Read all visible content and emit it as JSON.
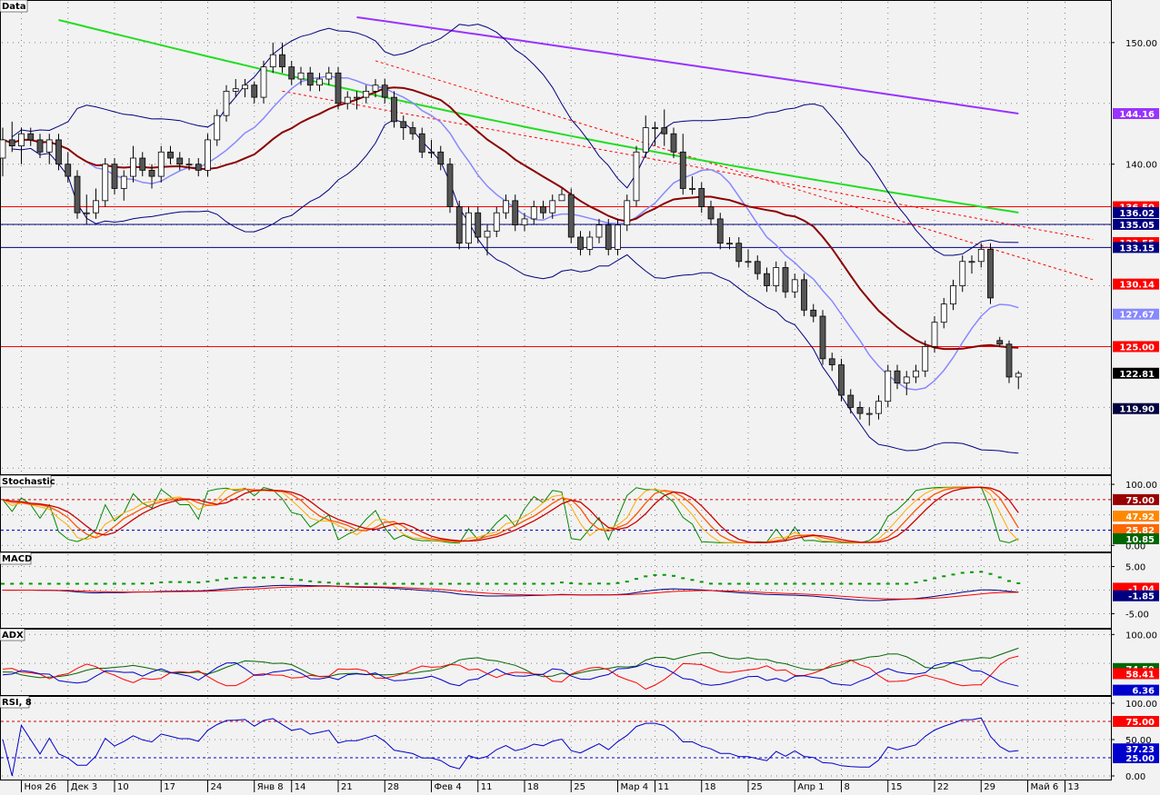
{
  "panels": {
    "price": {
      "title": "Data"
    },
    "stochastic": {
      "title": "Stochastic"
    },
    "macd": {
      "title": "MACD"
    },
    "adx": {
      "title": "ADX"
    },
    "rsi": {
      "title": "RSI, 8"
    }
  },
  "colors": {
    "background": "#f2f2f2",
    "grid": "#808080",
    "candle_up": "#ffffff",
    "candle_down": "#555555",
    "sma_long": "#9933ff",
    "sma_mid": "#22dd22",
    "sma_short": "#8b0000",
    "bb_mid": "#8888ff",
    "bb_band": "#000080",
    "level_red": "#ff0000",
    "level_blue": "#000080"
  },
  "x_axis": {
    "ticks": [
      {
        "label": "Ноя 26",
        "i": 2
      },
      {
        "label": "Дек 3",
        "i": 7
      },
      {
        "label": "10",
        "i": 12
      },
      {
        "label": "17",
        "i": 17
      },
      {
        "label": "24",
        "i": 22
      },
      {
        "label": "Янв 8",
        "i": 27
      },
      {
        "label": "14",
        "i": 31
      },
      {
        "label": "21",
        "i": 36
      },
      {
        "label": "28",
        "i": 41
      },
      {
        "label": "Фев 4",
        "i": 46
      },
      {
        "label": "11",
        "i": 51
      },
      {
        "label": "18",
        "i": 56
      },
      {
        "label": "25",
        "i": 61
      },
      {
        "label": "Мар 4",
        "i": 66
      },
      {
        "label": "11",
        "i": 70
      },
      {
        "label": "18",
        "i": 75
      },
      {
        "label": "25",
        "i": 80
      },
      {
        "label": "Апр 1",
        "i": 85
      },
      {
        "label": "8",
        "i": 90
      },
      {
        "label": "15",
        "i": 95
      },
      {
        "label": "22",
        "i": 100
      },
      {
        "label": "29",
        "i": 105
      },
      {
        "label": "Май 6",
        "i": 110
      },
      {
        "label": "13",
        "i": 114
      }
    ]
  },
  "right_labels": {
    "price_ticks": [
      "150.00",
      "140.00"
    ],
    "price_badges": [
      {
        "text": "144.16",
        "value": 144.16,
        "color": "#9933ff"
      },
      {
        "text": "136.50",
        "value": 136.5,
        "color": "#ff0000"
      },
      {
        "text": "136.02",
        "value": 136.02,
        "color": "#000080"
      },
      {
        "text": "135.05",
        "value": 135.05,
        "color": "#000080"
      },
      {
        "text": "133.55",
        "value": 133.55,
        "color": "#ff0000"
      },
      {
        "text": "133.15",
        "value": 133.15,
        "color": "#000080"
      },
      {
        "text": "130.14",
        "value": 130.14,
        "color": "#ff0000"
      },
      {
        "text": "127.67",
        "value": 127.67,
        "color": "#8888ff"
      },
      {
        "text": "125.00",
        "value": 125.0,
        "color": "#ff0000"
      },
      {
        "text": "122.81",
        "value": 122.81,
        "color": "#000000"
      },
      {
        "text": "119.90",
        "value": 119.9,
        "color": "#000040"
      }
    ],
    "stoch_ticks": [
      "100.00",
      "0.00"
    ],
    "stoch_badges": [
      {
        "text": "75.00",
        "value": 75,
        "color": "#990000"
      },
      {
        "text": "47.92",
        "value": 47.92,
        "color": "#ff8800"
      },
      {
        "text": "25.82",
        "value": 25.82,
        "color": "#ff6600"
      },
      {
        "text": "10.85",
        "value": 10.85,
        "color": "#006600"
      }
    ],
    "macd_ticks": [
      "5.00",
      "-5.00"
    ],
    "macd_badges": [
      {
        "text": "-1.04",
        "value": -1.04,
        "color": "#ff0000"
      },
      {
        "text": "-1.85",
        "value": -1.85,
        "color": "#000080"
      }
    ],
    "adx_ticks": [
      "100.00"
    ],
    "adx_badges": [
      {
        "text": "74.59",
        "value": 74.59,
        "color": "#006600"
      },
      {
        "text": "58.41",
        "value": 58.41,
        "color": "#ff0000"
      },
      {
        "text": "6.36",
        "value": 6.36,
        "color": "#0000cc"
      }
    ],
    "rsi_ticks": [
      "100.00",
      "50.00",
      "0.00"
    ],
    "rsi_badges": [
      {
        "text": "75.00",
        "value": 75,
        "color": "#ff0000"
      },
      {
        "text": "37.23",
        "value": 37.23,
        "color": "#0000cc"
      },
      {
        "text": "25.00",
        "value": 25,
        "color": "#0000cc"
      }
    ]
  },
  "chart_data": {
    "type": "candlestick",
    "price_range": [
      114.5,
      153.5
    ],
    "horizontal_levels": [
      {
        "value": 136.5,
        "color": "#ff0000"
      },
      {
        "value": 135.05,
        "color": "#000080"
      },
      {
        "value": 133.15,
        "color": "#000080"
      },
      {
        "value": 125.0,
        "color": "#ff0000"
      }
    ],
    "trend_lines": [
      {
        "from": [
          40,
          148.5
        ],
        "to": [
          117,
          130.5
        ],
        "color": "#ff0000"
      },
      {
        "from": [
          30,
          146.0
        ],
        "to": [
          117,
          133.8
        ],
        "color": "#ff0000"
      }
    ],
    "closes": [
      142,
      141.5,
      142.5,
      142.0,
      141.0,
      142.0,
      140.0,
      139.0,
      136.0,
      136.0,
      137.0,
      140.0,
      138.0,
      139.0,
      140.5,
      139.5,
      139.0,
      141.0,
      140.5,
      140.0,
      140.0,
      139.5,
      142.0,
      144.0,
      146.0,
      146.2,
      146.5,
      145.5,
      148.0,
      149.0,
      148.0,
      147.0,
      147.5,
      146.5,
      147.0,
      147.5,
      145.0,
      145.5,
      145.5,
      146.0,
      146.5,
      145.5,
      143.5,
      143.0,
      142.5,
      141.0,
      141.0,
      140.0,
      136.5,
      133.5,
      136.0,
      134.0,
      134.5,
      136.0,
      137.0,
      135.0,
      135.5,
      136.5,
      136.0,
      137.0,
      137.5,
      134.0,
      133.0,
      134.0,
      135.0,
      133.0,
      135.0,
      137.0,
      141.0,
      143.0,
      143.0,
      142.5,
      141.0,
      138.0,
      138.0,
      136.5,
      135.5,
      133.5,
      133.5,
      132.0,
      132.0,
      131.0,
      130.0,
      131.5,
      129.5,
      130.5,
      128.0,
      127.5,
      124.0,
      123.5,
      121.0,
      120.0,
      119.5,
      119.5,
      120.5,
      123.0,
      122.0,
      122.5,
      123.0,
      125.0,
      127.0,
      128.5,
      130.0,
      132.0,
      132.0,
      133.0,
      129.0,
      125.5,
      123.0,
      122.5
    ],
    "candles_sample_note": "OHLC estimated from chart",
    "ohlc": [
      [
        140.5,
        143.0,
        139.0,
        142.0
      ],
      [
        142.0,
        143.5,
        141.0,
        141.5
      ],
      [
        141.5,
        143.0,
        140.0,
        142.5
      ],
      [
        142.5,
        143.0,
        141.5,
        142.0
      ],
      [
        142.0,
        142.5,
        140.5,
        141.0
      ],
      [
        141.0,
        142.5,
        140.0,
        142.0
      ],
      [
        142.0,
        142.5,
        139.5,
        140.0
      ],
      [
        140.0,
        141.0,
        138.5,
        139.0
      ],
      [
        139.0,
        139.5,
        135.5,
        136.0
      ],
      [
        136.0,
        137.5,
        135.0,
        136.0
      ],
      [
        136.0,
        138.0,
        135.5,
        137.0
      ],
      [
        137.0,
        140.5,
        136.5,
        140.0
      ],
      [
        140.0,
        140.5,
        137.5,
        138.0
      ],
      [
        138.0,
        139.5,
        137.0,
        139.0
      ],
      [
        139.0,
        141.5,
        138.5,
        140.5
      ],
      [
        140.5,
        141.0,
        139.0,
        139.5
      ],
      [
        139.5,
        140.0,
        138.0,
        139.0
      ],
      [
        139.0,
        141.5,
        138.5,
        141.0
      ],
      [
        141.0,
        141.5,
        140.0,
        140.5
      ],
      [
        140.5,
        141.0,
        139.5,
        140.0
      ],
      [
        140.0,
        140.5,
        139.5,
        140.0
      ],
      [
        140.0,
        140.5,
        139.0,
        139.5
      ],
      [
        139.5,
        142.5,
        139.0,
        142.0
      ],
      [
        142.0,
        144.5,
        141.5,
        144.0
      ],
      [
        144.0,
        146.5,
        143.5,
        146.0
      ],
      [
        146.0,
        147.0,
        145.5,
        146.2
      ],
      [
        146.2,
        147.0,
        145.5,
        146.5
      ],
      [
        146.5,
        146.8,
        145.0,
        145.5
      ],
      [
        145.5,
        148.5,
        145.0,
        148.0
      ],
      [
        148.0,
        150.0,
        147.5,
        149.0
      ],
      [
        149.0,
        150.0,
        147.5,
        148.0
      ],
      [
        148.0,
        148.5,
        146.5,
        147.0
      ],
      [
        147.0,
        148.0,
        146.5,
        147.5
      ],
      [
        147.5,
        148.0,
        146.0,
        146.5
      ],
      [
        146.5,
        147.5,
        146.0,
        147.0
      ],
      [
        147.0,
        148.0,
        146.5,
        147.5
      ],
      [
        147.5,
        148.0,
        144.5,
        145.0
      ],
      [
        145.0,
        146.0,
        144.5,
        145.5
      ],
      [
        145.5,
        146.0,
        144.5,
        145.5
      ],
      [
        145.5,
        146.5,
        145.0,
        146.0
      ],
      [
        146.0,
        147.0,
        145.5,
        146.5
      ],
      [
        146.5,
        147.0,
        145.0,
        145.5
      ],
      [
        145.5,
        146.0,
        143.0,
        143.5
      ],
      [
        143.5,
        144.0,
        142.0,
        143.0
      ],
      [
        143.0,
        143.5,
        142.0,
        142.5
      ],
      [
        142.5,
        143.0,
        140.5,
        141.0
      ],
      [
        141.0,
        142.0,
        140.5,
        141.0
      ],
      [
        141.0,
        141.5,
        139.5,
        140.0
      ],
      [
        140.0,
        140.5,
        136.0,
        136.5
      ],
      [
        136.5,
        137.0,
        133.0,
        133.5
      ],
      [
        133.5,
        136.5,
        133.0,
        136.0
      ],
      [
        136.0,
        136.5,
        133.5,
        134.0
      ],
      [
        134.0,
        135.0,
        132.5,
        134.5
      ],
      [
        134.5,
        136.5,
        134.0,
        136.0
      ],
      [
        136.0,
        137.5,
        135.5,
        137.0
      ],
      [
        137.0,
        137.5,
        134.5,
        135.0
      ],
      [
        135.0,
        136.0,
        134.5,
        135.5
      ],
      [
        135.5,
        137.0,
        135.0,
        136.5
      ],
      [
        136.5,
        137.0,
        135.5,
        136.0
      ],
      [
        136.0,
        137.5,
        135.5,
        137.0
      ],
      [
        137.0,
        138.0,
        137.0,
        137.5
      ],
      [
        137.5,
        138.0,
        133.5,
        134.0
      ],
      [
        134.0,
        134.5,
        132.5,
        133.0
      ],
      [
        133.0,
        134.5,
        132.5,
        134.0
      ],
      [
        134.0,
        135.5,
        133.5,
        135.0
      ],
      [
        135.0,
        135.5,
        132.5,
        133.0
      ],
      [
        133.0,
        135.5,
        132.5,
        135.0
      ],
      [
        135.0,
        137.5,
        134.5,
        137.0
      ],
      [
        137.0,
        141.5,
        136.5,
        141.0
      ],
      [
        141.0,
        144.0,
        140.5,
        143.0
      ],
      [
        143.0,
        143.5,
        141.5,
        143.0
      ],
      [
        143.0,
        144.5,
        141.5,
        142.5
      ],
      [
        142.5,
        143.0,
        140.5,
        141.0
      ],
      [
        141.0,
        142.5,
        137.5,
        138.0
      ],
      [
        138.0,
        139.0,
        137.5,
        138.0
      ],
      [
        138.0,
        138.5,
        136.0,
        136.5
      ],
      [
        136.5,
        137.0,
        135.0,
        135.5
      ],
      [
        135.5,
        136.0,
        133.0,
        133.5
      ],
      [
        133.5,
        134.0,
        133.0,
        133.5
      ],
      [
        133.5,
        134.0,
        131.5,
        132.0
      ],
      [
        132.0,
        133.0,
        131.5,
        132.0
      ],
      [
        132.0,
        132.5,
        130.5,
        131.0
      ],
      [
        131.0,
        131.5,
        129.5,
        130.0
      ],
      [
        130.0,
        132.0,
        129.5,
        131.5
      ],
      [
        131.5,
        132.0,
        129.0,
        129.5
      ],
      [
        129.5,
        131.0,
        129.0,
        130.5
      ],
      [
        130.5,
        131.0,
        127.5,
        128.0
      ],
      [
        128.0,
        128.5,
        127.0,
        127.5
      ],
      [
        127.5,
        128.0,
        123.5,
        124.0
      ],
      [
        124.0,
        124.5,
        123.0,
        123.5
      ],
      [
        123.5,
        124.0,
        120.5,
        121.0
      ],
      [
        121.0,
        121.5,
        119.5,
        120.0
      ],
      [
        120.0,
        120.5,
        119.0,
        119.5
      ],
      [
        119.5,
        120.0,
        118.5,
        119.5
      ],
      [
        119.5,
        121.0,
        119.0,
        120.5
      ],
      [
        120.5,
        123.5,
        120.0,
        123.0
      ],
      [
        123.0,
        123.5,
        121.5,
        122.0
      ],
      [
        122.0,
        123.0,
        121.0,
        122.5
      ],
      [
        122.5,
        123.5,
        122.0,
        123.0
      ],
      [
        123.0,
        125.5,
        122.5,
        125.0
      ],
      [
        125.0,
        127.5,
        124.5,
        127.0
      ],
      [
        127.0,
        129.0,
        126.5,
        128.5
      ],
      [
        128.5,
        130.5,
        128.0,
        130.0
      ],
      [
        130.0,
        132.5,
        129.5,
        132.0
      ],
      [
        132.0,
        132.5,
        131.0,
        132.0
      ],
      [
        132.0,
        133.5,
        131.5,
        133.0
      ],
      [
        133.0,
        133.5,
        128.5,
        129.0
      ],
      [
        125.5,
        125.8,
        125.0,
        125.2
      ],
      [
        125.2,
        125.5,
        122.0,
        122.5
      ],
      [
        122.5,
        123.0,
        121.5,
        122.8
      ]
    ],
    "stochastic": {
      "range": [
        0,
        100
      ],
      "levels": [
        75,
        25
      ]
    },
    "macd": {
      "range": [
        -8,
        8
      ]
    },
    "adx": {
      "range": [
        0,
        110
      ]
    },
    "rsi": {
      "range": [
        0,
        110
      ],
      "levels": [
        75,
        25
      ]
    }
  }
}
